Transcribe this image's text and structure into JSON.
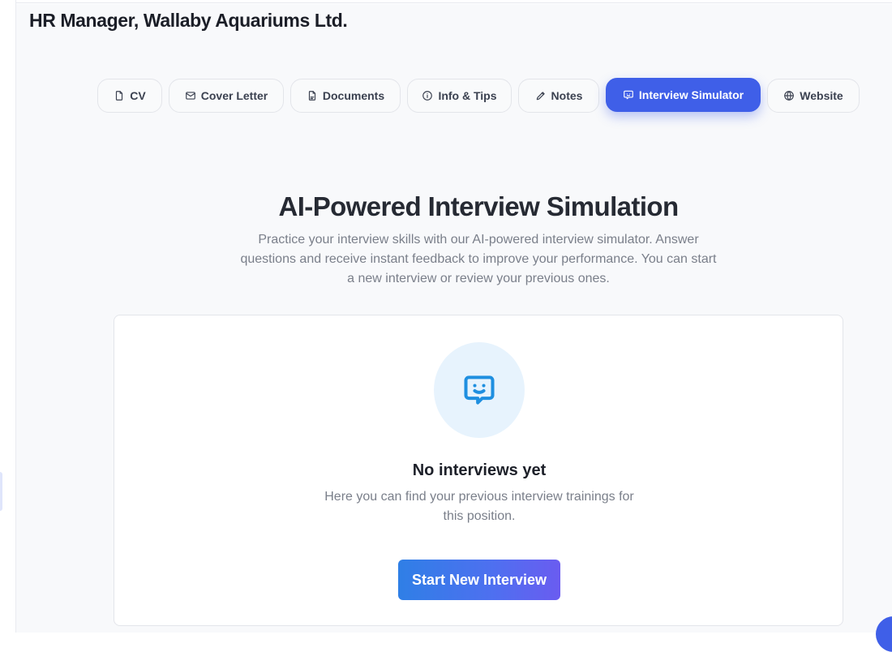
{
  "page": {
    "title": "HR Manager, Wallaby Aquariums Ltd."
  },
  "tabs": [
    {
      "label": "CV",
      "icon": "file-icon"
    },
    {
      "label": "Cover Letter",
      "icon": "mail-icon"
    },
    {
      "label": "Documents",
      "icon": "pdf-file-icon"
    },
    {
      "label": "Info & Tips",
      "icon": "info-icon"
    },
    {
      "label": "Notes",
      "icon": "pencil-icon"
    },
    {
      "label": "Interview Simulator",
      "icon": "chat-bubble-icon",
      "active": true
    },
    {
      "label": "Website",
      "icon": "globe-icon"
    }
  ],
  "simulator": {
    "heading": "AI-Powered Interview Simulation",
    "description": "Practice your interview skills with our AI-powered interview simulator. Answer questions and receive instant feedback to improve your performance. You can start a new interview or review your previous ones.",
    "empty_state": {
      "icon": "smiling-chat-icon",
      "title": "No interviews yet",
      "description": "Here you can find your previous interview trainings for this position.",
      "button_label": "Start New Interview"
    }
  },
  "colors": {
    "accent": "#3f5fe8",
    "icon_blue": "#1f8fe0",
    "icon_bg": "#e7f3fd"
  }
}
